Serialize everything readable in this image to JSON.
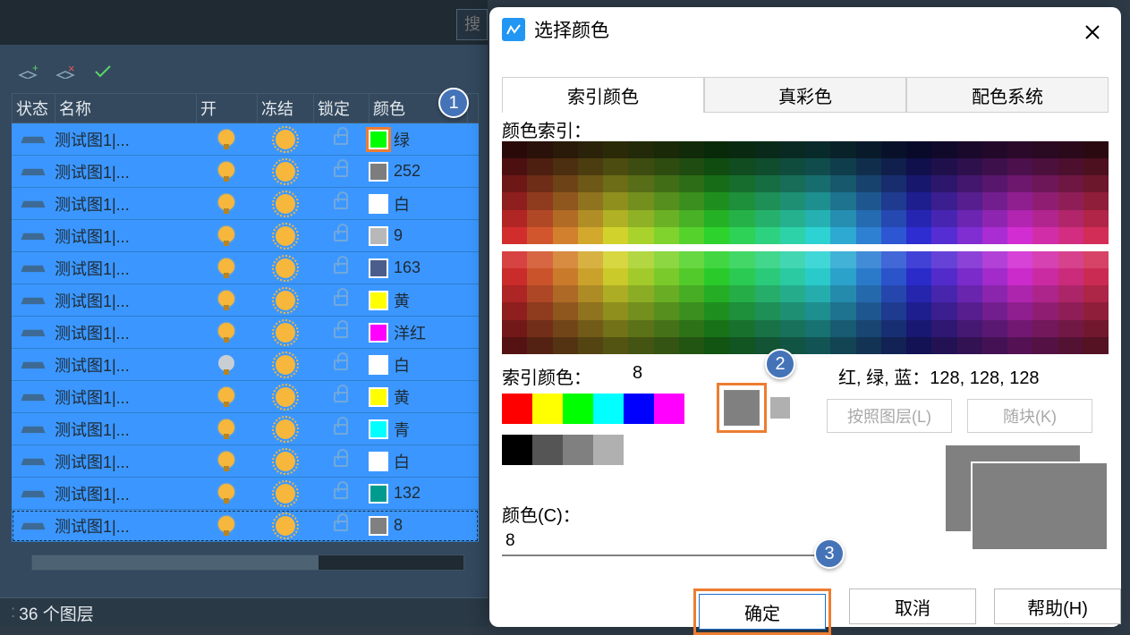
{
  "search": {
    "placeholder": "搜"
  },
  "toolbar": {
    "new_layer": "new-layer",
    "delete_layer": "delete-layer",
    "apply": "apply"
  },
  "columns": {
    "status": "状态",
    "name": "名称",
    "on": "开",
    "frozen": "冻结",
    "lock": "锁定",
    "color": "颜色"
  },
  "rows": [
    {
      "name": "测试图1|...",
      "on": true,
      "color_hex": "#00ff00",
      "color_label": "绿",
      "selected": true
    },
    {
      "name": "测试图1|...",
      "on": true,
      "color_hex": "#7d7d7d",
      "color_label": "252"
    },
    {
      "name": "测试图1|...",
      "on": true,
      "color_hex": "#ffffff",
      "color_label": "白"
    },
    {
      "name": "测试图1|...",
      "on": true,
      "color_hex": "#b8b8b8",
      "color_label": "9"
    },
    {
      "name": "测试图1|...",
      "on": true,
      "color_hex": "#4b5d8a",
      "color_label": "163"
    },
    {
      "name": "测试图1|...",
      "on": true,
      "color_hex": "#ffff00",
      "color_label": "黄"
    },
    {
      "name": "测试图1|...",
      "on": true,
      "color_hex": "#ff00ff",
      "color_label": "洋红"
    },
    {
      "name": "测试图1|...",
      "on": false,
      "color_hex": "#ffffff",
      "color_label": "白"
    },
    {
      "name": "测试图1|...",
      "on": true,
      "color_hex": "#ffff00",
      "color_label": "黄"
    },
    {
      "name": "测试图1|...",
      "on": true,
      "color_hex": "#00ffff",
      "color_label": "青"
    },
    {
      "name": "测试图1|...",
      "on": true,
      "color_hex": "#ffffff",
      "color_label": "白"
    },
    {
      "name": "测试图1|...",
      "on": true,
      "color_hex": "#009b8e",
      "color_label": "132"
    },
    {
      "name": "测试图1|...",
      "on": true,
      "color_hex": "#808080",
      "color_label": "8",
      "current": true
    }
  ],
  "status_bar": "36 个图层",
  "dialog": {
    "title": "选择颜色",
    "tabs": {
      "index": "索引颜色",
      "true": "真彩色",
      "system": "配色系统"
    },
    "label_index": "颜色索引：",
    "label_index2": "索引颜色：",
    "index_value": "8",
    "label_rgb": "红, 绿, 蓝：128, 128, 128",
    "btn_by_layer": "按照图层(L)",
    "btn_by_block": "随块(K)",
    "label_c": "颜色(C)：",
    "input_c": "8",
    "btn_ok": "确定",
    "btn_cancel": "取消",
    "btn_help": "帮助(H)",
    "selected_hex": "#808080",
    "mini": [
      "#ff0000",
      "#ffff00",
      "#00ff00",
      "#00ffff",
      "#0000ff",
      "#ff00ff"
    ],
    "grays": [
      "#000000",
      "#555555",
      "#808080",
      "#b0b0b0",
      "#ffffff"
    ]
  },
  "callouts": {
    "c1": "1",
    "c2": "2",
    "c3": "3"
  }
}
